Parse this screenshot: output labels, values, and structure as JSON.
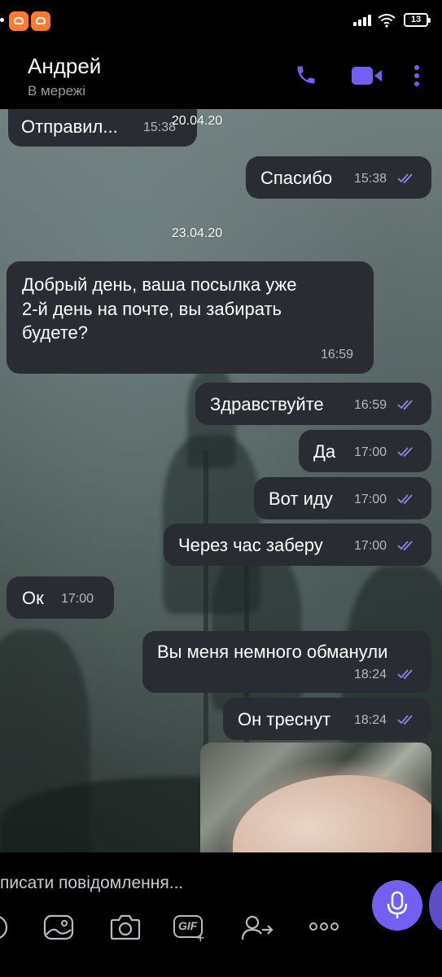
{
  "header": {
    "name": "Андрей",
    "status": "В мережі"
  },
  "status_bar": {
    "battery": "13"
  },
  "messages": [
    {
      "dir": "in",
      "text": "Отправил...",
      "time": "15:38"
    },
    {
      "dir": "date",
      "text": "20.04.20"
    },
    {
      "dir": "out",
      "text": "Спасибо",
      "time": "15:38"
    },
    {
      "dir": "date",
      "text": "23.04.20"
    },
    {
      "dir": "in",
      "lines": [
        "Добрый день, ваша посылка уже",
        "2-й день на почте, вы забирать",
        "будете?"
      ],
      "time": "16:59"
    },
    {
      "dir": "out",
      "text": "Здравствуйте",
      "time": "16:59"
    },
    {
      "dir": "out",
      "text": "Да",
      "time": "17:00"
    },
    {
      "dir": "out",
      "text": "Вот иду",
      "time": "17:00"
    },
    {
      "dir": "out",
      "text": "Через час заберу",
      "time": "17:00"
    },
    {
      "dir": "in",
      "text": "Ок",
      "time": "17:00"
    },
    {
      "dir": "out",
      "text": "Вы меня немного обманули",
      "time": "18:24"
    },
    {
      "dir": "out",
      "text": "Он треснут",
      "time": "18:24"
    }
  ],
  "composer": {
    "placeholder": "писати повідомлення..."
  },
  "toolbar": {
    "gif_label": "GIF",
    "more_label": "ooo"
  },
  "colors": {
    "accent": "#7360f2",
    "bubble": "#2a2c33",
    "tick": "#8f86e8"
  },
  "icons": [
    "phone-icon",
    "video-camera-icon",
    "more-vertical-icon",
    "microphone-icon",
    "sticker-icon",
    "image-icon",
    "camera-icon",
    "gif-icon",
    "share-contact-icon",
    "more-horizontal-icon"
  ]
}
